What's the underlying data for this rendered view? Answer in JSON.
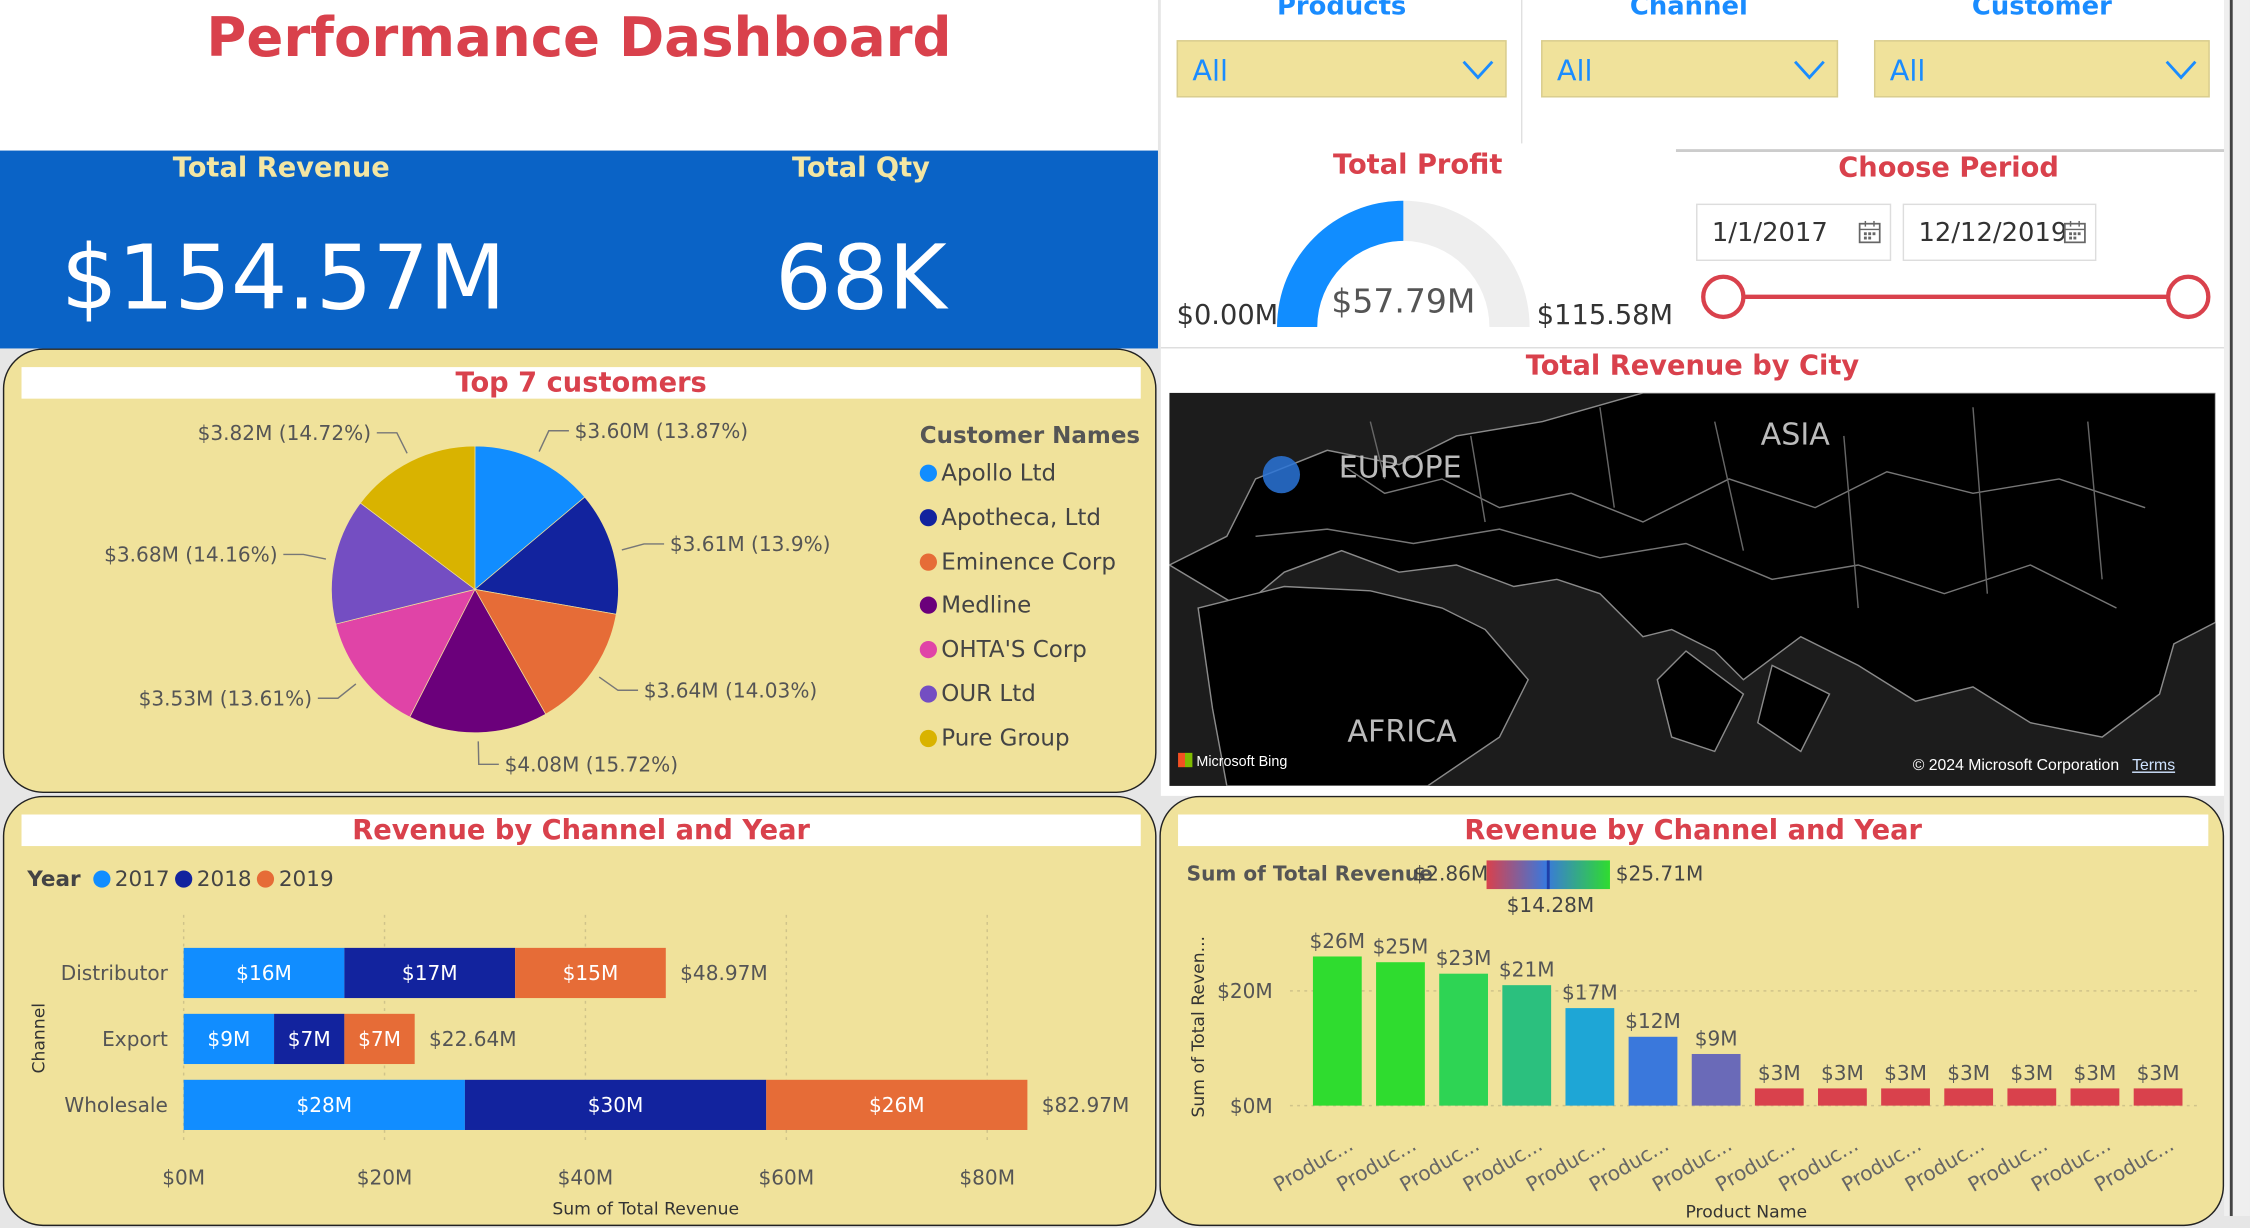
{
  "header": {
    "title": "Performance Dashboard"
  },
  "kpis": {
    "revenue_label": "Total Revenue",
    "revenue_value": "$154.57M",
    "qty_label": "Total Qty",
    "qty_value": "68K"
  },
  "slicers": [
    {
      "title": "Products",
      "value": "All"
    },
    {
      "title": "Channel",
      "value": "All"
    },
    {
      "title": "Customer",
      "value": "All"
    }
  ],
  "profit": {
    "title": "Total Profit",
    "value": "$57.79M",
    "min": "$0.00M",
    "max": "$115.58M",
    "fraction": 0.5
  },
  "period": {
    "title": "Choose Period",
    "start": "1/1/2017",
    "end": "12/12/2019"
  },
  "map": {
    "title": "Total Revenue by City",
    "labels": [
      "EUROPE",
      "ASIA",
      "AFRICA"
    ],
    "attribution": "Microsoft Bing",
    "copyright": "© 2024 Microsoft Corporation",
    "terms": "Terms"
  },
  "colors": {
    "accent_red": "#d9414c",
    "kpi_blue": "#0a63c6",
    "card_yellow": "#f0e29b"
  },
  "chart_data": [
    {
      "type": "pie",
      "title": "Top 7 customers",
      "legend_title": "Customer Names",
      "legend_position": "right",
      "labels": [
        "Apollo Ltd",
        "Apotheca, Ltd",
        "Eminence Corp",
        "Medline",
        "OHTA'S Corp",
        "OUR Ltd",
        "Pure Group"
      ],
      "values": [
        3.6,
        3.61,
        3.64,
        4.08,
        3.53,
        3.68,
        3.82
      ],
      "data_labels": [
        "$3.60M (13.87%)",
        "$3.61M (13.9%)",
        "$3.64M (14.03%)",
        "$4.08M (15.72%)",
        "$3.53M (13.61%)",
        "$3.68M (14.16%)",
        "$3.82M (14.72%)"
      ],
      "colors": [
        "#118dff",
        "#12239e",
        "#e66c37",
        "#6b007b",
        "#e044a7",
        "#744ec2",
        "#d9b300"
      ]
    },
    {
      "type": "bar",
      "orientation": "horizontal",
      "stacked": true,
      "title": "Revenue by Channel and Year",
      "legend_title": "Year",
      "legend_position": "top-left",
      "categories": [
        "Distributor",
        "Export",
        "Wholesale"
      ],
      "series": [
        {
          "name": "2017",
          "values": [
            16,
            9,
            28
          ],
          "labels": [
            "$16M",
            "$9M",
            "$28M"
          ],
          "color": "#118dff"
        },
        {
          "name": "2018",
          "values": [
            17,
            7,
            30
          ],
          "labels": [
            "$17M",
            "$7M",
            "$30M"
          ],
          "color": "#12239e"
        },
        {
          "name": "2019",
          "values": [
            15,
            7,
            26
          ],
          "labels": [
            "$15M",
            "$7M",
            "$26M"
          ],
          "color": "#e66c37"
        }
      ],
      "totals": [
        "$48.97M",
        "$22.64M",
        "$82.97M"
      ],
      "xlabel": "Sum of Total Revenue",
      "ylabel": "Channel",
      "xticks": [
        "$0M",
        "$20M",
        "$40M",
        "$60M",
        "$80M"
      ],
      "xlim": [
        0,
        85
      ]
    },
    {
      "type": "bar",
      "orientation": "vertical",
      "title": "Revenue by Channel and Year",
      "color_scale": {
        "label": "Sum of Total Revenue",
        "min": "$2.86M",
        "mid": "$14.28M",
        "max": "$25.71M"
      },
      "categories": [
        "Produc...",
        "Produc...",
        "Produc...",
        "Produc...",
        "Produc...",
        "Produc...",
        "Produc...",
        "Produc...",
        "Produc...",
        "Produc...",
        "Produc...",
        "Produc...",
        "Produc...",
        "Produc..."
      ],
      "values": [
        26,
        25,
        23,
        21,
        17,
        12,
        9,
        3,
        3,
        3,
        3,
        3,
        3,
        3
      ],
      "data_labels": [
        "$26M",
        "$25M",
        "$23M",
        "$21M",
        "$17M",
        "$12M",
        "$9M",
        "$3M",
        "$3M",
        "$3M",
        "$3M",
        "$3M",
        "$3M",
        "$3M"
      ],
      "colors": [
        "#2fdc2f",
        "#2fdc2f",
        "#2ed454",
        "#2bc07e",
        "#1ea6d6",
        "#3a78dc",
        "#6a6ab8",
        "#d9414c",
        "#d9414c",
        "#d9414c",
        "#d9414c",
        "#d9414c",
        "#d9414c",
        "#d9414c"
      ],
      "xlabel": "Product Name",
      "ylabel": "Sum of Total Reven...",
      "yticks": [
        "$0M",
        "$20M"
      ],
      "ylim": [
        0,
        30
      ]
    }
  ]
}
